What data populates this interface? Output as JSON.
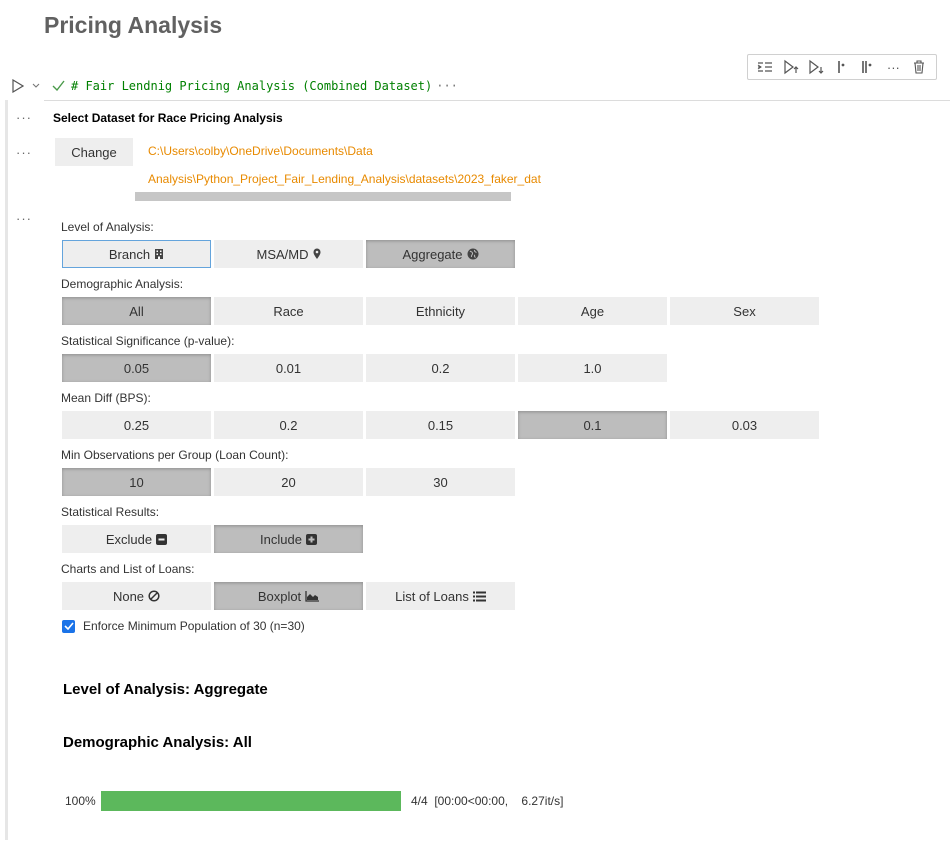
{
  "page": {
    "title": "Pricing Analysis"
  },
  "cell": {
    "code_line": "# Fair Lendnig Pricing Analysis (Combined Dataset)",
    "code_more": "···",
    "toolbar": [
      "execute-above-icon",
      "run-above-icon",
      "run-below-icon",
      "split-cell-icon",
      "join-cells-icon",
      "more-icon",
      "delete-icon"
    ]
  },
  "dataset": {
    "heading": "Select Dataset for Race Pricing Analysis",
    "change_label": "Change",
    "path_line1": "C:\\Users\\colby\\OneDrive\\Documents\\Data",
    "path_line2": "Analysis\\Python_Project_Fair_Lending_Analysis\\datasets\\2023_faker_dat"
  },
  "level": {
    "label": "Level of Analysis:",
    "options": [
      {
        "text": "Branch",
        "icon": "building-icon",
        "state": "focused"
      },
      {
        "text": "MSA/MD",
        "icon": "map-marker-icon",
        "state": "normal"
      },
      {
        "text": "Aggregate",
        "icon": "globe-icon",
        "state": "selected"
      }
    ]
  },
  "demographic": {
    "label": "Demographic Analysis:",
    "options": [
      {
        "text": "All",
        "state": "selected"
      },
      {
        "text": "Race",
        "state": "normal"
      },
      {
        "text": "Ethnicity",
        "state": "normal"
      },
      {
        "text": "Age",
        "state": "normal"
      },
      {
        "text": "Sex",
        "state": "normal"
      }
    ]
  },
  "significance": {
    "label": "Statistical Significance (p-value):",
    "options": [
      {
        "text": "0.05",
        "state": "selected"
      },
      {
        "text": "0.01",
        "state": "normal"
      },
      {
        "text": "0.2",
        "state": "normal"
      },
      {
        "text": "1.0",
        "state": "normal"
      }
    ]
  },
  "mean_diff": {
    "label": "Mean Diff (BPS):",
    "options": [
      {
        "text": "0.25",
        "state": "normal"
      },
      {
        "text": "0.2",
        "state": "normal"
      },
      {
        "text": "0.15",
        "state": "normal"
      },
      {
        "text": "0.1",
        "state": "selected"
      },
      {
        "text": "0.03",
        "state": "normal"
      }
    ]
  },
  "min_obs": {
    "label": "Min Observations per Group (Loan Count):",
    "options": [
      {
        "text": "10",
        "state": "selected"
      },
      {
        "text": "20",
        "state": "normal"
      },
      {
        "text": "30",
        "state": "normal"
      }
    ]
  },
  "stat_results": {
    "label": "Statistical Results:",
    "options": [
      {
        "text": "Exclude",
        "icon": "minus-square-icon",
        "state": "normal"
      },
      {
        "text": "Include",
        "icon": "plus-square-icon",
        "state": "selected"
      }
    ]
  },
  "charts": {
    "label": "Charts and List of Loans:",
    "options": [
      {
        "text": "None",
        "icon": "ban-icon",
        "state": "normal"
      },
      {
        "text": "Boxplot",
        "icon": "area-chart-icon",
        "state": "selected"
      },
      {
        "text": "List of Loans",
        "icon": "list-icon",
        "state": "normal"
      }
    ]
  },
  "enforce": {
    "label": "Enforce Minimum Population of 30 (n=30)",
    "checked": true
  },
  "results": {
    "level_heading": "Level of Analysis: Aggregate",
    "demo_heading": "Demographic Analysis: All"
  },
  "progress": {
    "percent_label": "100%",
    "fraction": 1.0,
    "stats": "4/4  [00:00<00:00,    6.27it/s]"
  },
  "colors": {
    "selected": "#bdbdbd",
    "button": "#eeeeee",
    "path": "#e88a00",
    "progress": "#5cb85c"
  }
}
